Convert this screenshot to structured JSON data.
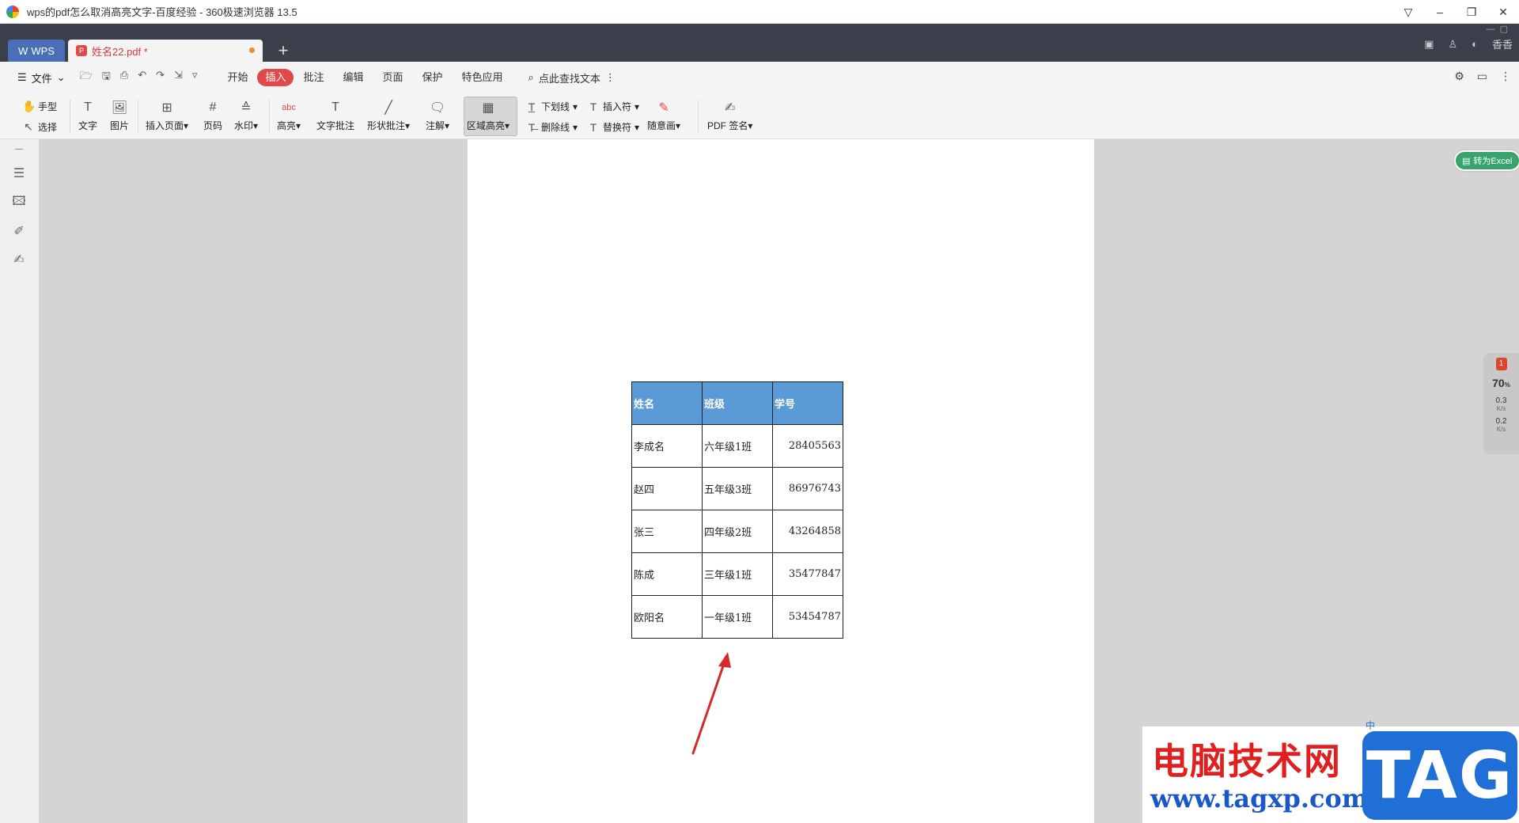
{
  "browser": {
    "title": "wps的pdf怎么取消高亮文字-百度经验 - 360极速浏览器 13.5",
    "controls": [
      "▽",
      "–",
      "❐",
      "✕"
    ]
  },
  "tabs": {
    "home_label": "WPS",
    "doc_label": "姓名22.pdf *",
    "new_tab": "+",
    "right_user": "香香"
  },
  "menubar": {
    "file_label": "文件",
    "tabs": [
      "开始",
      "插入",
      "批注",
      "编辑",
      "页面",
      "保护",
      "特色应用"
    ],
    "active_tab": "插入",
    "search_label": "点此查找文本"
  },
  "ribbon": {
    "hand": "手型",
    "select": "选择",
    "text": "文字",
    "image": "图片",
    "insert_page": "插入页面",
    "page_num": "页码",
    "watermark": "水印",
    "highlight": "高亮",
    "text_comment": "文字批注",
    "shape_comment": "形状批注",
    "note": "注解",
    "area_highlight": "区域高亮",
    "underline": "下划线",
    "strikethrough": "删除线",
    "insert_char": "插入符",
    "replace_char": "替换符",
    "freehand": "随意画",
    "pdf_sign": "PDF 签名"
  },
  "table": {
    "headers": [
      "姓名",
      "班级",
      "学号"
    ],
    "rows": [
      [
        "李成名",
        "六年级1班",
        "28405563"
      ],
      [
        "赵四",
        "五年级3班",
        "86976743"
      ],
      [
        "张三",
        "四年级2班",
        "43264858"
      ],
      [
        "陈成",
        "三年级1班",
        "35477847"
      ],
      [
        "欧阳名",
        "一年级1班",
        "53454787"
      ]
    ]
  },
  "right_float": {
    "excel_button": "转为Excel",
    "badge": "1",
    "percent": "70",
    "percent_unit": "%",
    "up_speed": "0.3",
    "down_speed": "0.2",
    "speed_unit": "K/s"
  },
  "watermark": {
    "cn_text": "电脑技术网",
    "url": "www.tagxp.com",
    "tag": "TAG",
    "ime_text": "中"
  },
  "colors": {
    "accent": "#e04a4a",
    "table_header": "#5a9ad6",
    "arrow": "#d42a2a",
    "wps_blue": "#4a6fb8"
  }
}
